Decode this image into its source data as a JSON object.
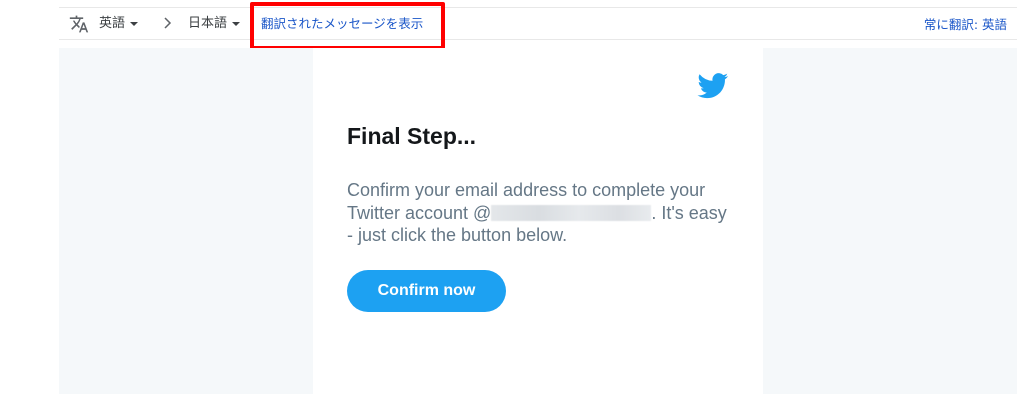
{
  "translate_bar": {
    "icon": "translate-icon",
    "source_language": "英語",
    "arrow_icon": "chevron-right-icon",
    "target_language": "日本語",
    "show_translation_label": "翻訳されたメッセージを表示",
    "always_translate_label": "常に翻訳: 英語",
    "link_color": "#1a56c8"
  },
  "annotation": {
    "highlight_color": "#ff0000"
  },
  "email": {
    "logo_icon": "twitter-bird-icon",
    "headline": "Final Step...",
    "body_before": "Confirm your email address to complete your Twitter account @",
    "body_after": ". It's easy - just click the button below.",
    "confirm_button_label": "Confirm now",
    "brand_color": "#1da1f2",
    "background_color": "#f5f8fa"
  }
}
